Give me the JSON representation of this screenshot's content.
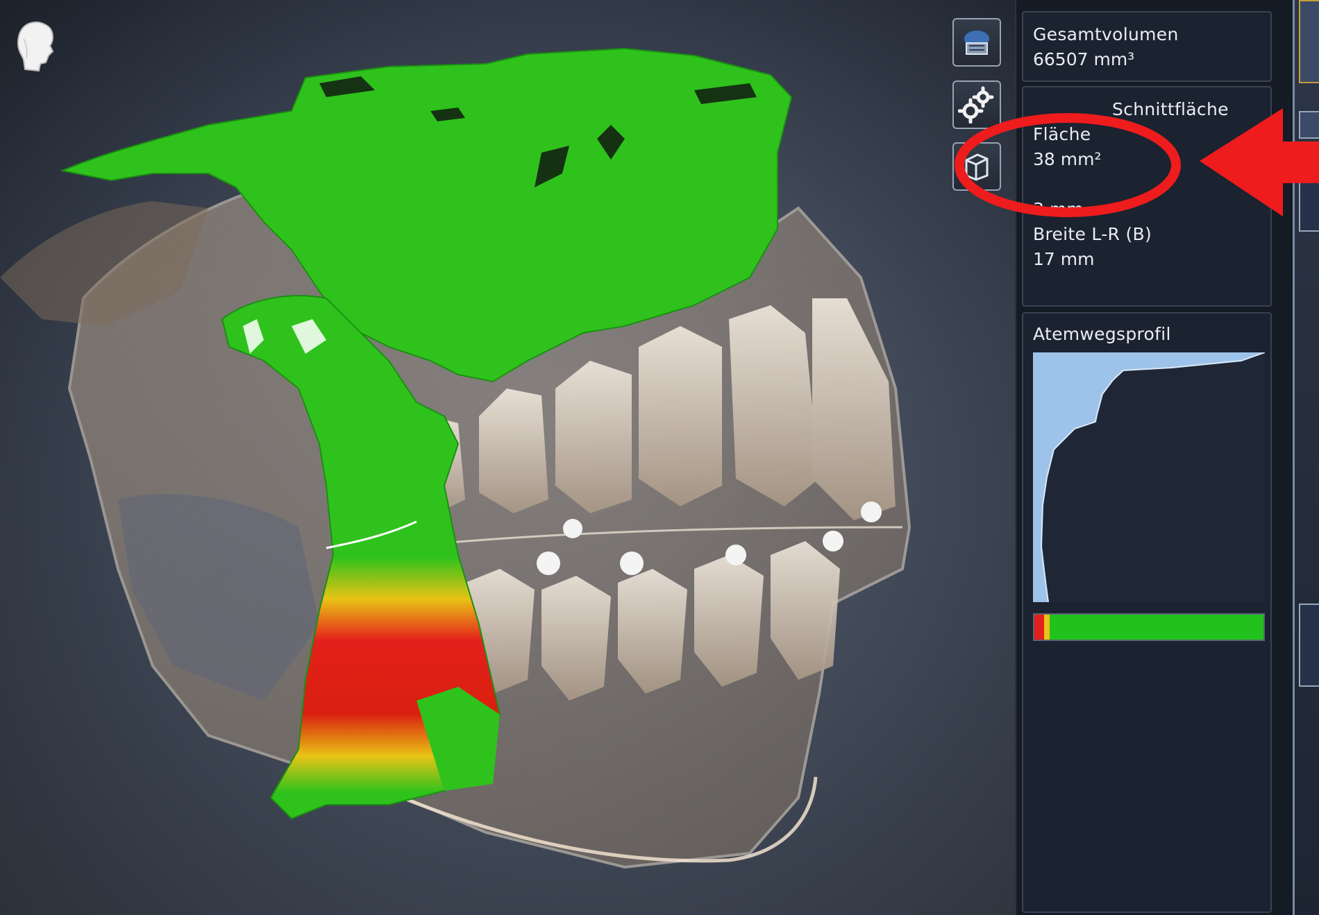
{
  "viewport": {
    "scene_description_icon": "head-orientation-icon",
    "tools": [
      {
        "name": "3d-view-icon"
      },
      {
        "name": "settings-gears-icon"
      },
      {
        "name": "cube-icon"
      }
    ]
  },
  "panel": {
    "total_volume": {
      "label": "Gesamtvolumen",
      "value": "66507 mm³"
    },
    "cross_section": {
      "title": "Schnittfläche",
      "area_label": "Fläche",
      "area_value": "38 mm²",
      "depth_value": "3 mm",
      "width_label": "Breite L-R (B)",
      "width_value": "17 mm"
    },
    "airway_profile": {
      "title": "Atemwegsprofil"
    }
  },
  "colors": {
    "airway_green": "#2fc21c",
    "airway_red": "#e3201b",
    "airway_yellow": "#e9c316",
    "annotation_red": "#ee1c1c",
    "profile_blue": "#9ec3ea"
  }
}
